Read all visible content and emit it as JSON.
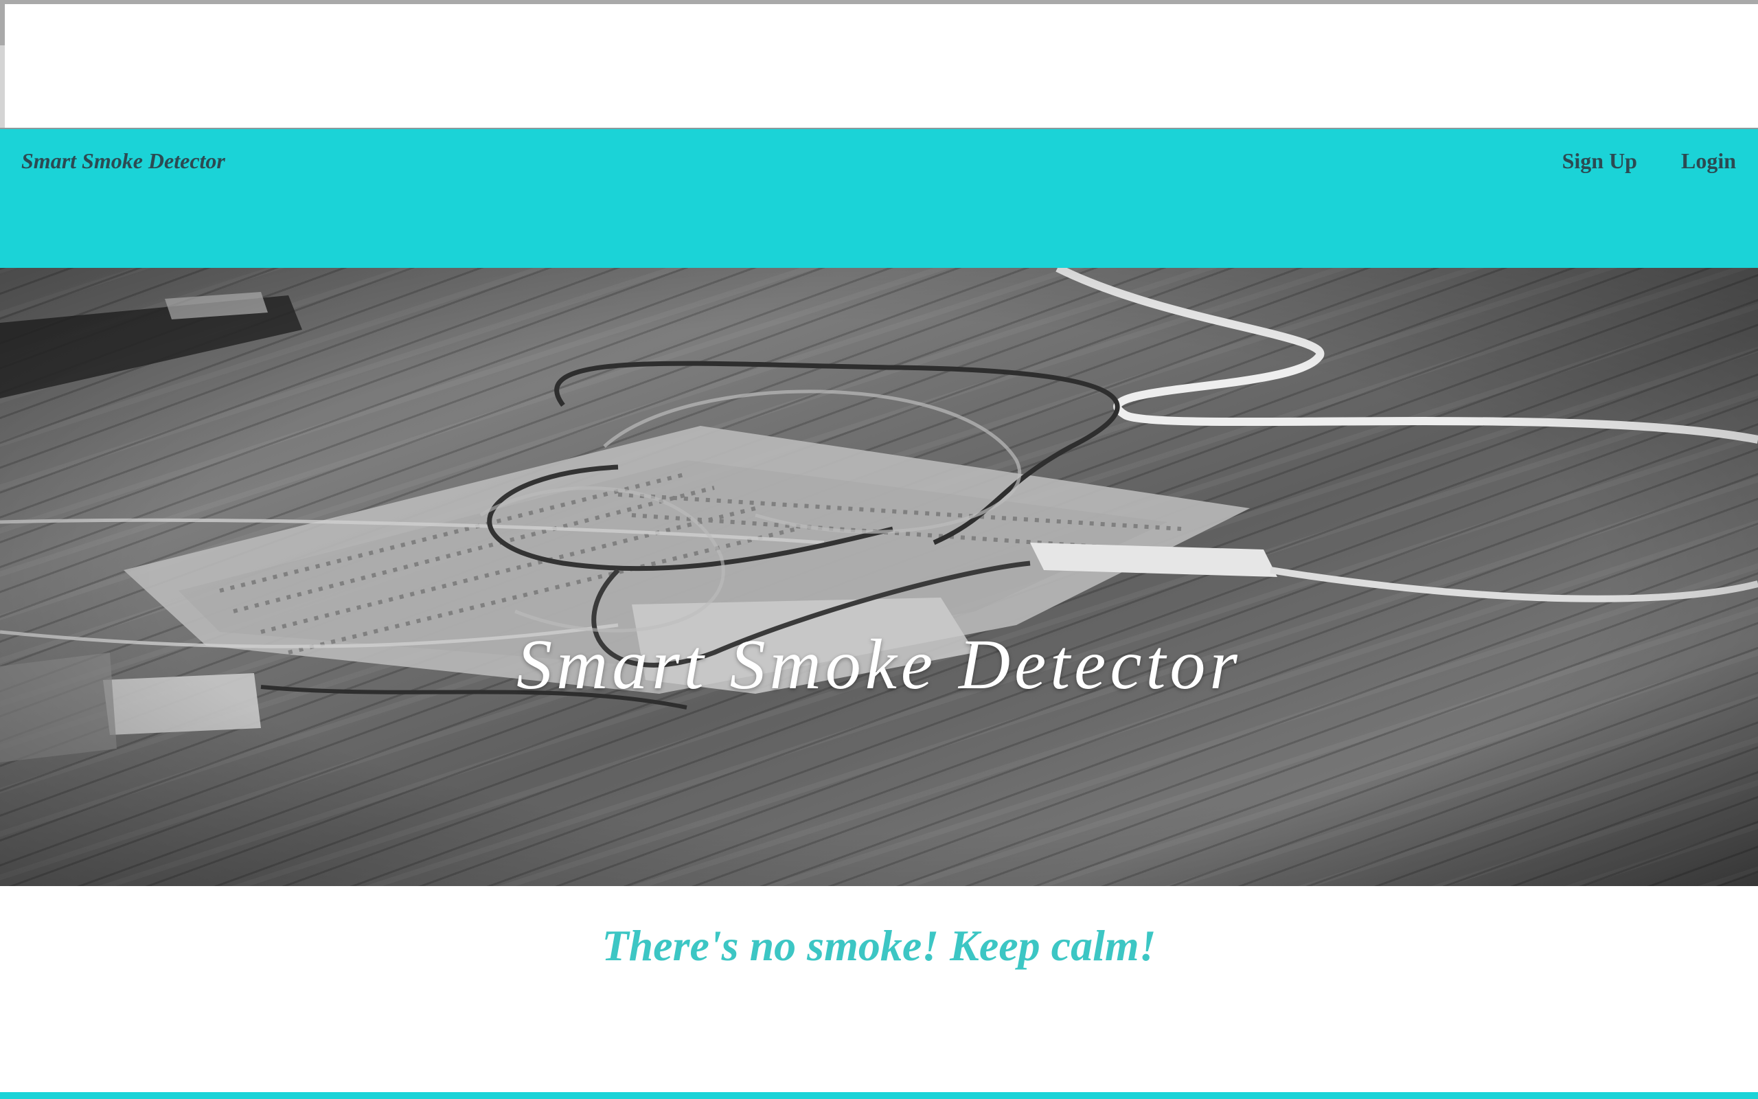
{
  "navbar": {
    "brand": "Smart Smoke Detector",
    "links": [
      {
        "label": "Sign Up"
      },
      {
        "label": "Login"
      }
    ]
  },
  "hero": {
    "title": "Smart Smoke Detector"
  },
  "status": {
    "message": "There's no smoke! Keep calm!"
  },
  "colors": {
    "navbar_bg": "#1bd3d7",
    "nav_text": "#2c4a52",
    "status_text": "#3cc6c4",
    "hero_text": "#ffffff"
  }
}
